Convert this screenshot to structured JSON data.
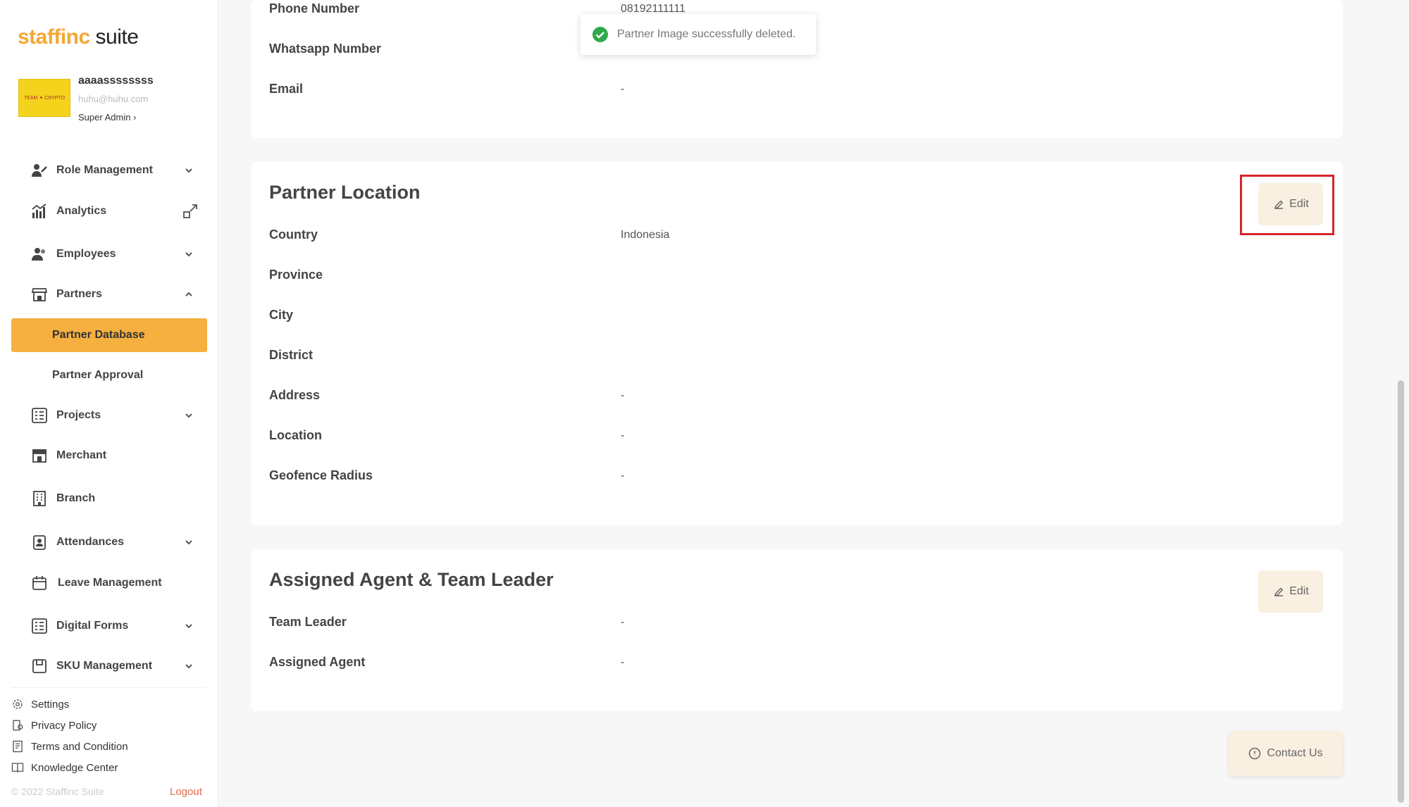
{
  "brand": {
    "logo_part1": "staffinc",
    "logo_part2": " suite"
  },
  "profile": {
    "name": "aaaassssssss",
    "email": "huhu@huhu.com",
    "role": "Super Admin ›",
    "avatar_text": "TEAM ✦ CRYPTO"
  },
  "nav": {
    "role_management": "Role Management",
    "analytics": "Analytics",
    "employees": "Employees",
    "partners": "Partners",
    "partner_database": "Partner Database",
    "partner_approval": "Partner Approval",
    "projects": "Projects",
    "merchant": "Merchant",
    "branch": "Branch",
    "attendances": "Attendances",
    "leave_management": "Leave Management",
    "digital_forms": "Digital Forms",
    "sku_management": "SKU Management"
  },
  "footer": {
    "settings": "Settings",
    "privacy": "Privacy Policy",
    "terms": "Terms and Condition",
    "knowledge": "Knowledge Center",
    "copyright": "© 2022 Staffinc Suite",
    "logout": "Logout"
  },
  "contact_section": {
    "phone_label": "Phone Number",
    "phone_value": "08192111111",
    "whatsapp_label": "Whatsapp Number",
    "email_label": "Email",
    "email_value": "-"
  },
  "toast": {
    "message": "Partner Image successfully deleted."
  },
  "location": {
    "title": "Partner Location",
    "edit": "Edit",
    "country_label": "Country",
    "country_value": "Indonesia",
    "province_label": "Province",
    "city_label": "City",
    "district_label": "District",
    "address_label": "Address",
    "address_value": "-",
    "location_label": "Location",
    "location_value": "-",
    "geofence_label": "Geofence Radius",
    "geofence_value": "-"
  },
  "assigned": {
    "title": "Assigned Agent & Team Leader",
    "edit": "Edit",
    "team_leader_label": "Team Leader",
    "team_leader_value": "-",
    "agent_label": "Assigned Agent",
    "agent_value": "-"
  },
  "contact_button": "Contact Us",
  "colors": {
    "accent": "#f5b040",
    "highlight": "#d8242a",
    "success": "#2eaa4a"
  }
}
